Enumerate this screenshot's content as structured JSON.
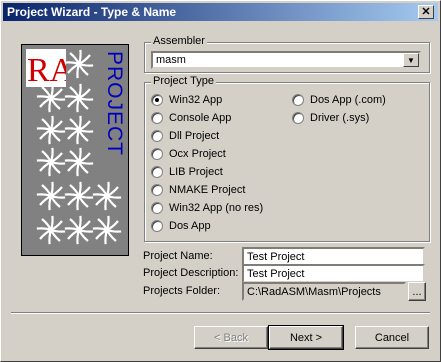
{
  "window": {
    "title": "Project Wizard - Type & Name",
    "close_glyph": "✕"
  },
  "banner": {
    "logo_text": "RA",
    "word": "PROJECT"
  },
  "assembler": {
    "group_label": "Assembler",
    "selected": "masm"
  },
  "project_type": {
    "group_label": "Project Type",
    "options": [
      {
        "label": "Win32 App",
        "checked": true
      },
      {
        "label": "Console App",
        "checked": false
      },
      {
        "label": "Dll Project",
        "checked": false
      },
      {
        "label": "Ocx Project",
        "checked": false
      },
      {
        "label": "LIB Project",
        "checked": false
      },
      {
        "label": "NMAKE Project",
        "checked": false
      },
      {
        "label": "Win32 App (no res)",
        "checked": false
      },
      {
        "label": "Dos App",
        "checked": false
      },
      {
        "label": "Dos App (.com)",
        "checked": false
      },
      {
        "label": "Driver (.sys)",
        "checked": false
      }
    ]
  },
  "fields": {
    "name_label": "Project Name:",
    "name_value": "Test Project",
    "desc_label": "Project Description:",
    "desc_value": "Test Project",
    "folder_label": "Projects Folder:",
    "folder_value": "C:\\RadASM\\Masm\\Projects",
    "browse_label": "..."
  },
  "buttons": {
    "back": "< Back",
    "next": "Next >",
    "cancel": "Cancel"
  }
}
